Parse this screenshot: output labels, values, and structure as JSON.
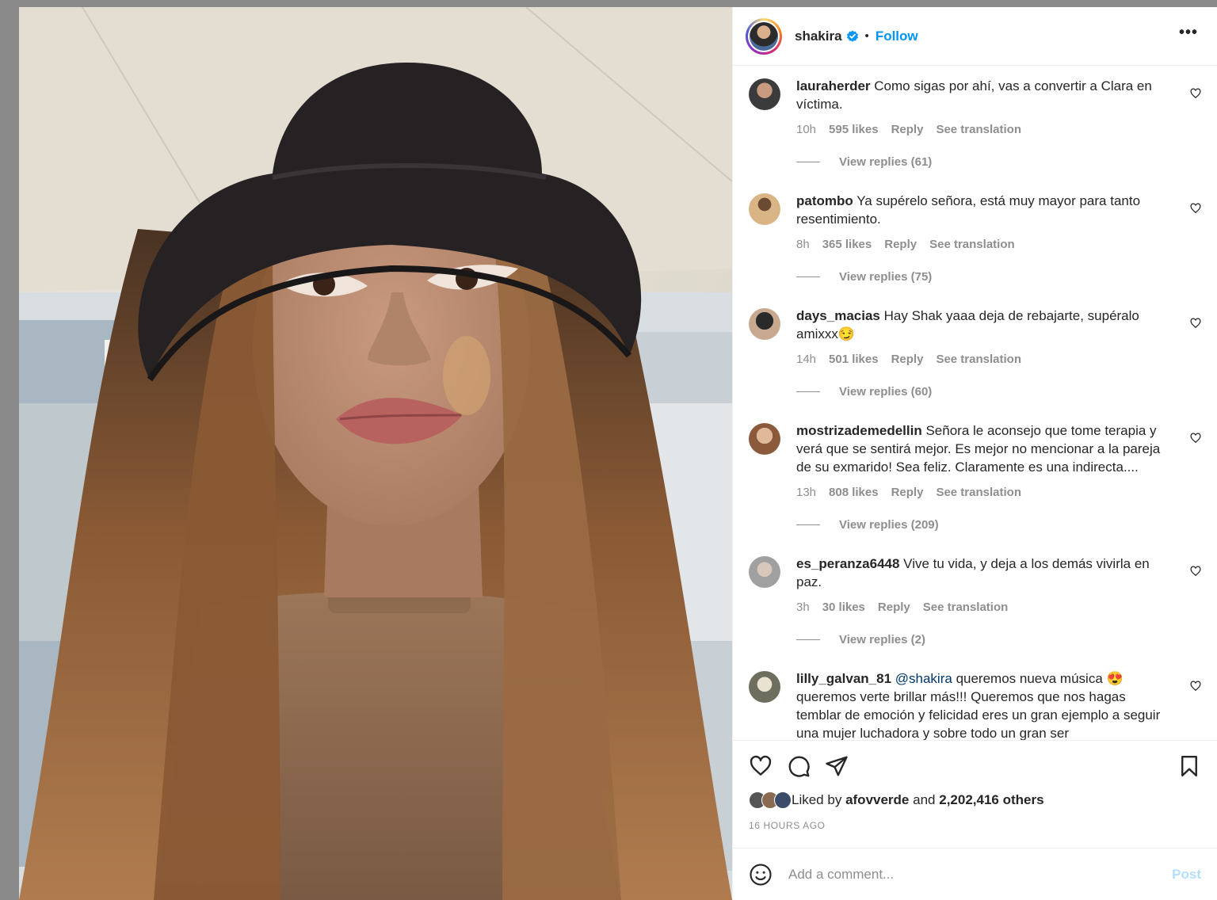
{
  "header": {
    "username": "shakira",
    "separator": "•",
    "follow_label": "Follow",
    "more_label": "•••"
  },
  "comments": [
    {
      "username": "lauraherder",
      "text": "Como sigas por ahí, vas a convertir a Clara en víctima.",
      "time": "10h",
      "likes": "595 likes",
      "reply": "Reply",
      "translate": "See translation",
      "view_replies": "View replies (61)",
      "avatar_color": "#3b3b3b"
    },
    {
      "username": "patombo",
      "text": "Ya supérelo señora, está muy mayor para tanto resentimiento.",
      "time": "8h",
      "likes": "365 likes",
      "reply": "Reply",
      "translate": "See translation",
      "view_replies": "View replies (75)",
      "avatar_color": "#b08a5a"
    },
    {
      "username": "days_macias",
      "text": "Hay Shak yaaa deja de rebajarte, supéralo amixxx",
      "emoji": "😏",
      "time": "14h",
      "likes": "501 likes",
      "reply": "Reply",
      "translate": "See translation",
      "view_replies": "View replies (60)",
      "avatar_color": "#2a2a2a"
    },
    {
      "username": "mostrizademedellin",
      "text": "Señora le aconsejo que tome terapia y verá que se sentirá mejor. Es mejor no mencionar a la pareja de su exmarido! Sea feliz. Claramente es una indirecta....",
      "time": "13h",
      "likes": "808 likes",
      "reply": "Reply",
      "translate": "See translation",
      "view_replies": "View replies (209)",
      "avatar_color": "#c8a27e"
    },
    {
      "username": "es_peranza6448",
      "text": "Vive tu vida, y deja a los demás vivirla en paz.",
      "time": "3h",
      "likes": "30 likes",
      "reply": "Reply",
      "translate": "See translation",
      "view_replies": "View replies (2)",
      "avatar_color": "#9a9a9a"
    },
    {
      "username": "lilly_galvan_81",
      "mention": "@shakira",
      "text": "queremos nueva música",
      "emoji": "😍",
      "text2": "queremos verte brillar más!!! Queremos que nos hagas temblar de emoción y felicidad eres un gran ejemplo a seguir una mujer luchadora y sobre todo un gran ser",
      "avatar_color": "#7a7a6a"
    }
  ],
  "actions": {
    "like_icon": "heart-icon",
    "comment_icon": "comment-bubble-icon",
    "share_icon": "paper-plane-icon",
    "save_icon": "bookmark-icon"
  },
  "likes": {
    "prefix": "Liked by",
    "user": "afovverde",
    "conjunction": "and",
    "others": "2,202,416 others"
  },
  "timestamp": "16 HOURS AGO",
  "add_comment": {
    "placeholder": "Add a comment...",
    "post_label": "Post"
  },
  "colors": {
    "follow": "#0095f6",
    "post_disabled": "#b2dffc",
    "muted": "#8e8e8e"
  }
}
